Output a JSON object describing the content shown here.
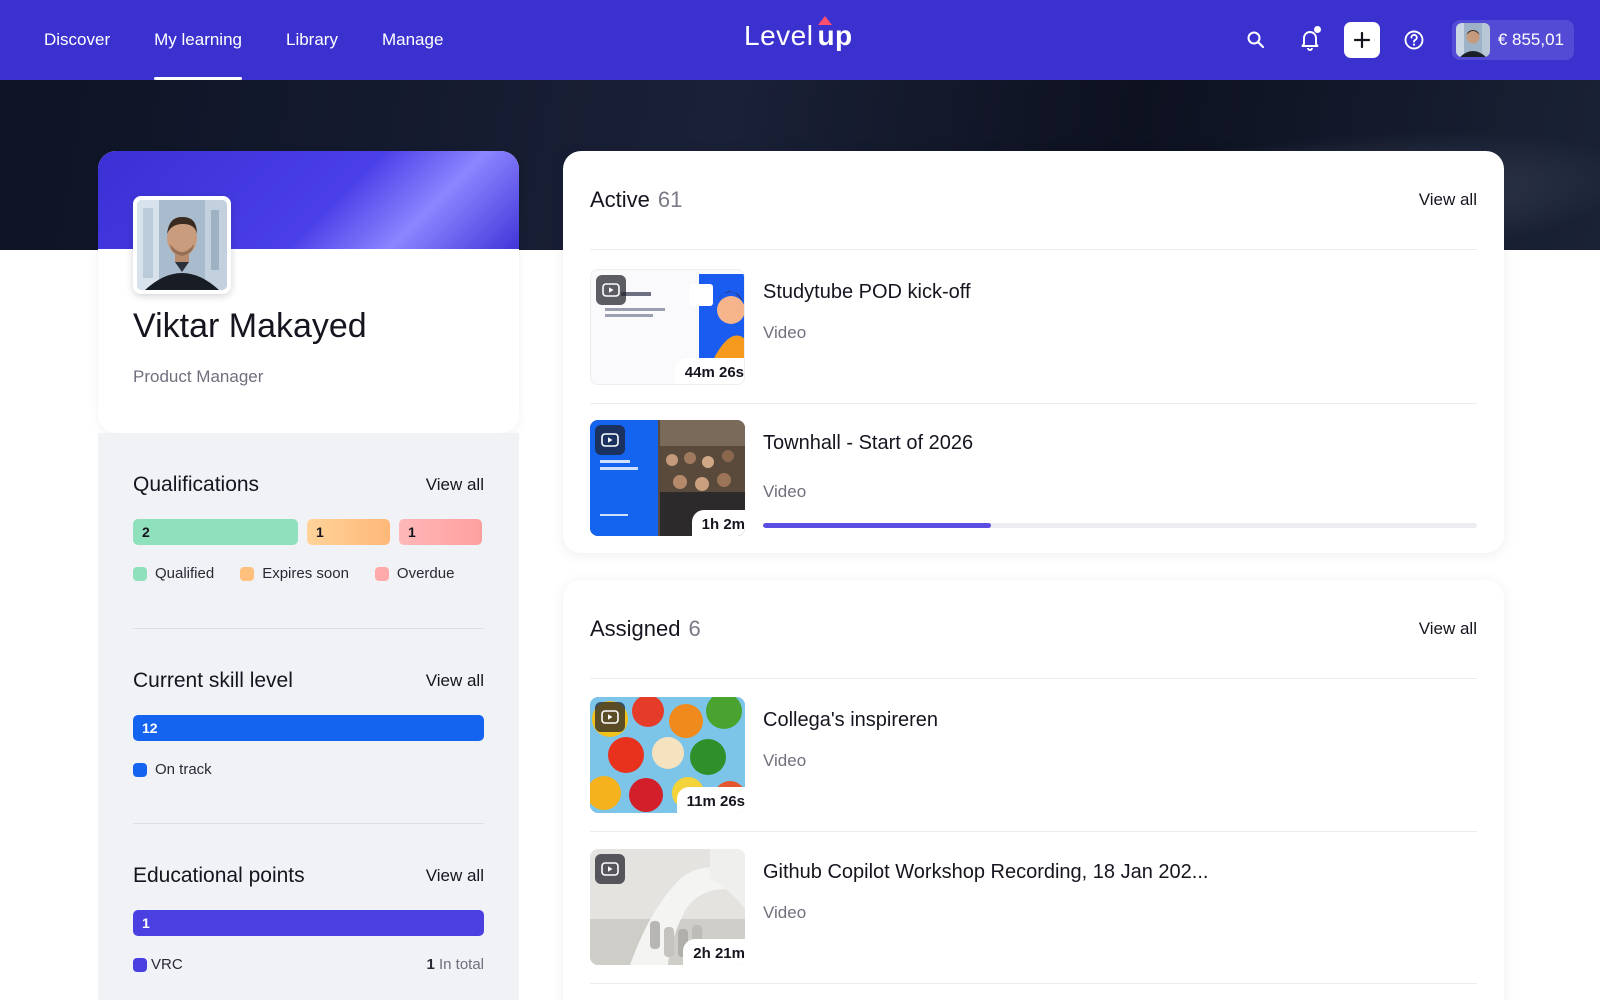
{
  "nav": {
    "items": [
      {
        "label": "Discover",
        "active": false
      },
      {
        "label": "My learning",
        "active": true
      },
      {
        "label": "Library",
        "active": false
      },
      {
        "label": "Manage",
        "active": false
      }
    ]
  },
  "logo": {
    "part1": "Level",
    "part2": "up"
  },
  "header_actions": {
    "icons": [
      "search-icon",
      "bell-icon",
      "plus-icon",
      "help-icon"
    ],
    "wallet_amount": "€ 855,01"
  },
  "profile": {
    "name": "Viktar Makayed",
    "role": "Product Manager"
  },
  "qualifications": {
    "title": "Qualifications",
    "view_all": "View all",
    "segments": [
      {
        "label": "Qualified",
        "count": "2",
        "color": "#8fe0bd"
      },
      {
        "label": "Expires soon",
        "count": "1",
        "color": "#ffc07d"
      },
      {
        "label": "Overdue",
        "count": "1",
        "color": "#ffaaaa"
      }
    ]
  },
  "skill_level": {
    "title": "Current skill level",
    "view_all": "View all",
    "value": "12",
    "legend": "On track",
    "color": "#1464f0"
  },
  "educational_points": {
    "title": "Educational points",
    "view_all": "View all",
    "value": "1",
    "legend": "VRC",
    "total_value": "1",
    "total_label": "In total",
    "color": "#4a3fe0"
  },
  "active": {
    "title": "Active",
    "count": "61",
    "view_all": "View all",
    "items": [
      {
        "title": "Studytube POD kick-off",
        "type": "Video",
        "duration": "44m 26s"
      },
      {
        "title": "Townhall - Start of 2026",
        "type": "Video",
        "duration": "1h 2m",
        "progress": 0.32
      }
    ]
  },
  "assigned": {
    "title": "Assigned",
    "count": "6",
    "view_all": "View all",
    "items": [
      {
        "title": "Collega's inspireren",
        "type": "Video",
        "duration": "11m 26s"
      },
      {
        "title": "Github Copilot Workshop Recording, 18 Jan 202...",
        "type": "Video",
        "duration": "2h 21m"
      }
    ]
  },
  "colors": {
    "brand": "#3a31cf",
    "accent_pink": "#ff4f6d"
  }
}
